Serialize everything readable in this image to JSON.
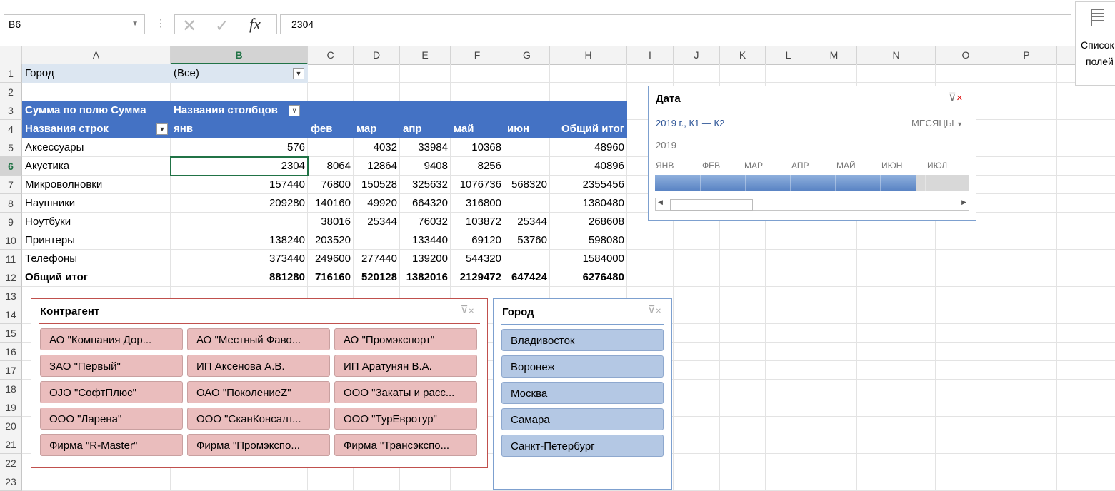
{
  "formula_bar": {
    "name_box": "B6",
    "fx_label": "fx",
    "formula": "2304"
  },
  "field_list": {
    "line1": "Список",
    "line2": "полей",
    "icon": "field-list-icon"
  },
  "columns": [
    "A",
    "B",
    "C",
    "D",
    "E",
    "F",
    "G",
    "H",
    "I",
    "J",
    "K",
    "L",
    "M",
    "N",
    "O",
    "P"
  ],
  "rows": [
    "1",
    "2",
    "3",
    "4",
    "5",
    "6",
    "7",
    "8",
    "9",
    "10",
    "11",
    "12",
    "13",
    "14",
    "15",
    "16",
    "17",
    "18",
    "19",
    "20",
    "21",
    "22",
    "23"
  ],
  "pivot": {
    "filter_label": "Город",
    "filter_value": "(Все)",
    "sum_label": "Сумма по полю Сумма",
    "col_labels": "Названия столбцов",
    "row_labels": "Названия строк",
    "months": [
      "янв",
      "фев",
      "мар",
      "апр",
      "май",
      "июн"
    ],
    "total_label": "Общий итог",
    "rows": [
      {
        "name": "Аксессуары",
        "vals": [
          "576",
          "",
          "4032",
          "33984",
          "10368",
          ""
        ],
        "total": "48960"
      },
      {
        "name": "Акустика",
        "vals": [
          "2304",
          "8064",
          "12864",
          "9408",
          "8256",
          ""
        ],
        "total": "40896"
      },
      {
        "name": "Микроволновки",
        "vals": [
          "157440",
          "76800",
          "150528",
          "325632",
          "1076736",
          "568320"
        ],
        "total": "2355456"
      },
      {
        "name": "Наушники",
        "vals": [
          "209280",
          "140160",
          "49920",
          "664320",
          "316800",
          ""
        ],
        "total": "1380480"
      },
      {
        "name": "Ноутбуки",
        "vals": [
          "",
          "38016",
          "25344",
          "76032",
          "103872",
          "25344"
        ],
        "total": "268608"
      },
      {
        "name": "Принтеры",
        "vals": [
          "138240",
          "203520",
          "",
          "133440",
          "69120",
          "53760"
        ],
        "total": "598080"
      },
      {
        "name": "Телефоны",
        "vals": [
          "373440",
          "249600",
          "277440",
          "139200",
          "544320",
          ""
        ],
        "total": "1584000"
      }
    ],
    "grand": {
      "name": "Общий итог",
      "vals": [
        "881280",
        "716160",
        "520128",
        "1382016",
        "2129472",
        "647424"
      ],
      "total": "6276480"
    }
  },
  "timeline": {
    "title": "Дата",
    "range": "2019 г., К1 — К2",
    "level": "МЕСЯЦЫ",
    "year": "2019",
    "months": [
      "ЯНВ",
      "ФЕВ",
      "МАР",
      "АПР",
      "МАЙ",
      "ИЮН",
      "ИЮЛ"
    ],
    "selected_fraction": 0.83
  },
  "slicer_contragent": {
    "title": "Контрагент",
    "items": [
      "АО \"Компания Дор...",
      "АО \"Местный Фаво...",
      "АО \"Промэкспорт\"",
      "ЗАО \"Первый\"",
      "ИП Аксенова А.В.",
      "ИП Аратунян В.А.",
      "ОЈО \"СофтПлюс\"",
      "ОАО \"ПоколениеZ\"",
      "ООО \"Закаты и расс...",
      "ООО \"Ларена\"",
      "ООО \"СканКонсалт...",
      "ООО \"ТурЕвротур\"",
      "Фирма \"R-Master\"",
      "Фирма \"Промэкспо...",
      "Фирма \"Трансэкспо..."
    ]
  },
  "slicer_city": {
    "title": "Город",
    "items": [
      "Владивосток",
      "Воронеж",
      "Москва",
      "Самара",
      "Санкт-Петербург"
    ]
  },
  "colors": {
    "pivot_header": "#4472c4",
    "selected_header": "#217346",
    "slicer_pink": "#eabdbd",
    "slicer_blue": "#b4c8e4",
    "timeline_bar": "#6d93cf"
  }
}
